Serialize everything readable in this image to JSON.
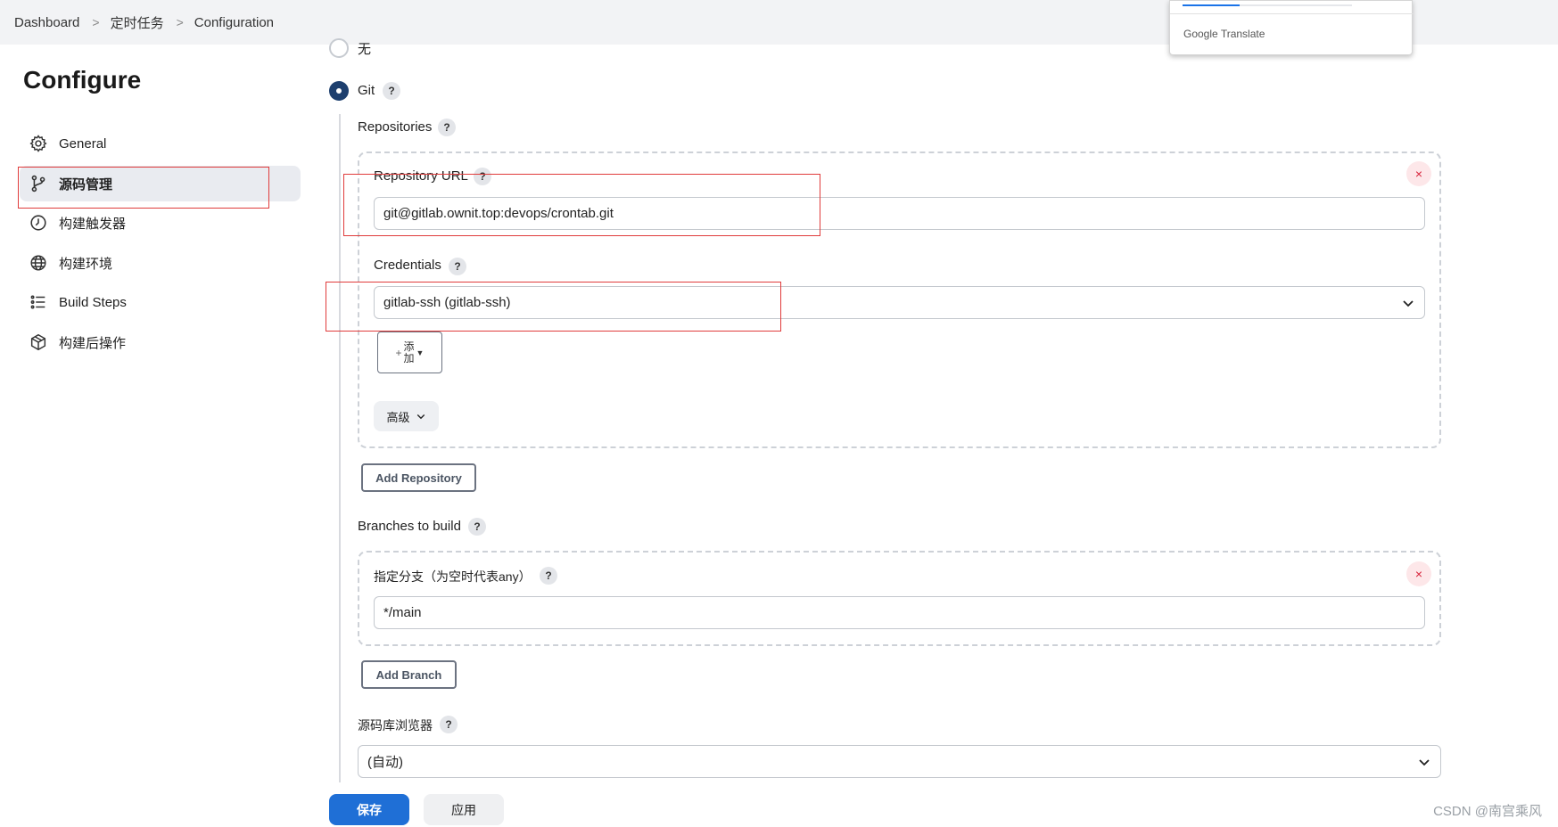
{
  "breadcrumb": {
    "items": [
      "Dashboard",
      "定时任务",
      "Configuration"
    ],
    "separator": ">"
  },
  "sidebar": {
    "title": "Configure",
    "items": [
      {
        "label": "General",
        "icon": "gear-icon"
      },
      {
        "label": "源码管理",
        "icon": "git-branch-icon",
        "active": true
      },
      {
        "label": "构建触发器",
        "icon": "clock-icon"
      },
      {
        "label": "构建环境",
        "icon": "globe-icon"
      },
      {
        "label": "Build Steps",
        "icon": "list-icon"
      },
      {
        "label": "构建后操作",
        "icon": "package-icon"
      }
    ]
  },
  "scm": {
    "option_none": "无",
    "option_git": "Git",
    "help": "?",
    "repositories_label": "Repositories",
    "repository_url_label": "Repository URL",
    "repository_url_value": "git@gitlab.ownit.top:devops/crontab.git",
    "credentials_label": "Credentials",
    "credentials_value": "gitlab-ssh (gitlab-ssh)",
    "add_credentials_plus": "+",
    "add_credentials_label_1": "添",
    "add_credentials_label_2": "加",
    "advanced_label": "高级",
    "add_repository_label": "Add Repository",
    "branches_label": "Branches to build",
    "branch_specifier_label": "指定分支（为空时代表any）",
    "branch_specifier_value": "*/main",
    "add_branch_label": "Add Branch",
    "repo_browser_label": "源码库浏览器",
    "repo_browser_value": "(自动)",
    "remove_symbol": "×"
  },
  "actions": {
    "save_label": "保存",
    "apply_label": "应用"
  },
  "translate_popup": {
    "brand": "Google",
    "product": "Translate"
  },
  "watermark": "CSDN @南宫乘风",
  "colors": {
    "accent": "#1f6fd6",
    "radio_selected": "#1d3f6e",
    "highlight_border": "#e03b3b",
    "remove_red": "#d8223a"
  }
}
